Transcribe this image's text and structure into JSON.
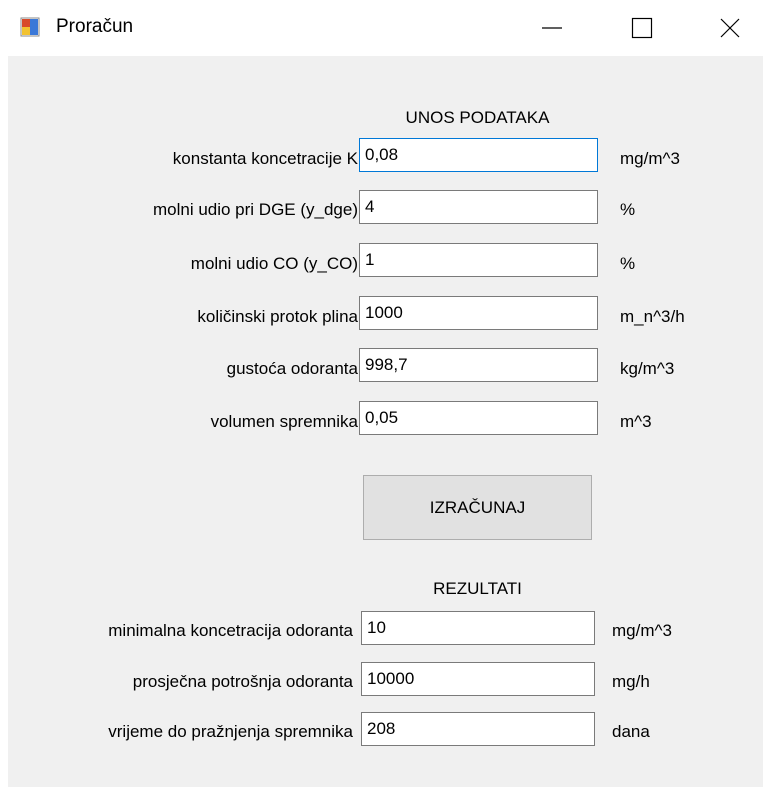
{
  "window": {
    "title": "Proračun",
    "icon": "form-app-icon",
    "controls": [
      "minimize-icon",
      "maximize-icon",
      "close-icon"
    ]
  },
  "input_section": {
    "title": "UNOS PODATAKA",
    "fields": [
      {
        "label": "konstanta koncetracije K",
        "value": "0,08",
        "unit": "mg/m^3"
      },
      {
        "label": "molni udio pri DGE (y_dge)",
        "value": "4",
        "unit": "%"
      },
      {
        "label": "molni udio CO (y_CO)",
        "value": "1",
        "unit": "%"
      },
      {
        "label": "količinski protok plina",
        "value": "1000",
        "unit": "m_n^3/h"
      },
      {
        "label": "gustoća odoranta",
        "value": "998,7",
        "unit": "kg/m^3"
      },
      {
        "label": "volumen spremnika",
        "value": "0,05",
        "unit": "m^3"
      }
    ]
  },
  "calculate_button": {
    "label": "IZRAČUNAJ"
  },
  "results_section": {
    "title": "REZULTATI",
    "fields": [
      {
        "label": "minimalna koncetracija odoranta",
        "value": "10",
        "unit": "mg/m^3"
      },
      {
        "label": "prosječna potrošnja odoranta",
        "value": "10000",
        "unit": "mg/h"
      },
      {
        "label": "vrijeme do pražnjenja spremnika",
        "value": "208",
        "unit": "dana"
      }
    ]
  },
  "colors": {
    "client_background": "#f0f0f0",
    "focus_border": "#0078d7",
    "button_background": "#e1e1e1"
  }
}
